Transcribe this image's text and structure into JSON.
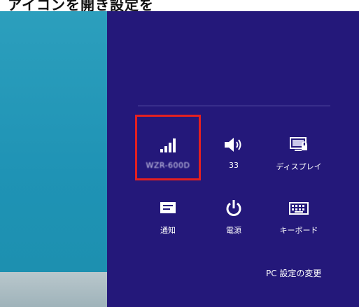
{
  "caption": {
    "text": "】アイコンを開き設定を"
  },
  "charm": {
    "tiles": [
      {
        "label": "WZR-600D",
        "icon": "wifi-signal-icon"
      },
      {
        "label": "33",
        "icon": "volume-icon"
      },
      {
        "label": "ディスプレイ",
        "icon": "display-icon"
      },
      {
        "label": "通知",
        "icon": "notification-icon"
      },
      {
        "label": "電源",
        "icon": "power-icon"
      },
      {
        "label": "キーボード",
        "icon": "keyboard-icon"
      }
    ],
    "settings_link": "PC 設定の変更"
  },
  "colors": {
    "charm_bg": "#24187a",
    "desktop": "#1f93b5",
    "highlight": "#e52020"
  }
}
